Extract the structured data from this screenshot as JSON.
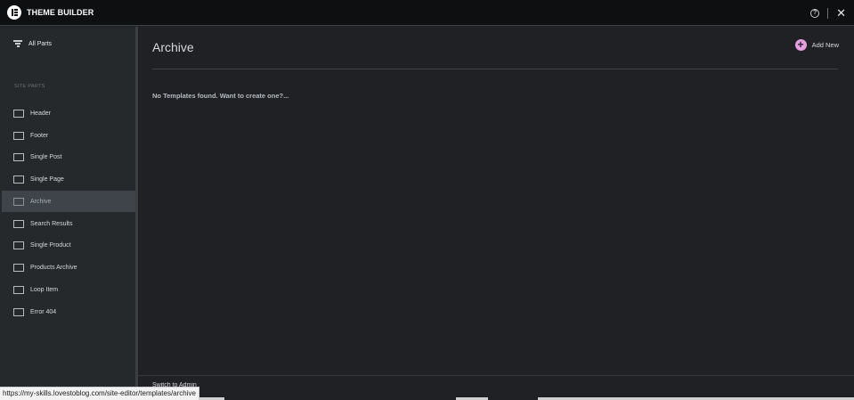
{
  "topbar": {
    "title": "THEME BUILDER"
  },
  "sidebar": {
    "all_parts_label": "All Parts",
    "section_label": "SITE PARTS",
    "items": [
      {
        "label": "Header",
        "icon": "header-template-icon",
        "active": false
      },
      {
        "label": "Footer",
        "icon": "footer-template-icon",
        "active": false
      },
      {
        "label": "Single Post",
        "icon": "single-post-icon",
        "active": false
      },
      {
        "label": "Single Page",
        "icon": "single-page-icon",
        "active": false
      },
      {
        "label": "Archive",
        "icon": "archive-icon",
        "active": true
      },
      {
        "label": "Search Results",
        "icon": "search-results-icon",
        "active": false
      },
      {
        "label": "Single Product",
        "icon": "single-product-icon",
        "active": false
      },
      {
        "label": "Products Archive",
        "icon": "products-archive-icon",
        "active": false
      },
      {
        "label": "Loop Item",
        "icon": "loop-item-icon",
        "active": false
      },
      {
        "label": "Error 404",
        "icon": "error-404-icon",
        "active": false
      }
    ]
  },
  "main": {
    "title": "Archive",
    "add_new_label": "Add New",
    "empty_message": "No Templates found. Want to create one?...",
    "footer_text": "Switch to Admin"
  },
  "status_url": "https://my-skills.lovestoblog.com/site-editor/templates/archive",
  "colors": {
    "accent": "#e59ee0",
    "background": "#1f2124",
    "sidebar": "#26292c",
    "active_item": "#3f444b"
  }
}
